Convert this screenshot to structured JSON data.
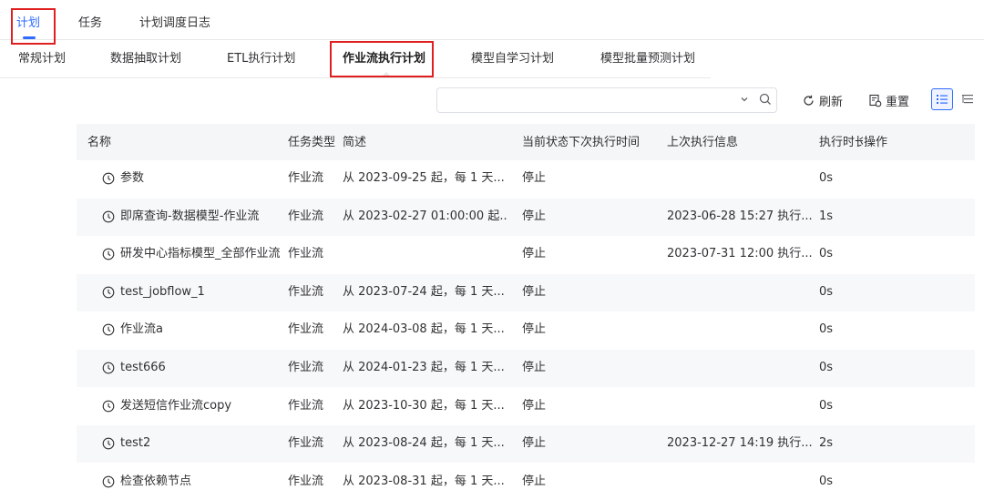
{
  "top_tabs": [
    {
      "label": "计划",
      "active": true
    },
    {
      "label": "任务",
      "active": false
    },
    {
      "label": "计划调度日志",
      "active": false
    }
  ],
  "sub_tabs": [
    {
      "label": "常规计划",
      "active": false
    },
    {
      "label": "数据抽取计划",
      "active": false
    },
    {
      "label": "ETL执行计划",
      "active": false
    },
    {
      "label": "作业流执行计划",
      "active": true
    },
    {
      "label": "模型自学习计划",
      "active": false
    },
    {
      "label": "模型批量预测计划",
      "active": false
    }
  ],
  "search": {
    "value": "",
    "placeholder": ""
  },
  "toolbar": {
    "refresh_label": "刷新",
    "reset_label": "重置"
  },
  "table": {
    "headers": {
      "name": "名称",
      "task_type": "任务类型",
      "description": "简述",
      "status": "当前状态",
      "next_time": "下次执行时间",
      "last_info": "上次执行信息",
      "duration": "执行时长",
      "actions": "操作"
    },
    "rows": [
      {
        "name": "参数",
        "task_type": "作业流",
        "description": "从 2023-09-25 起，每 1 天...",
        "status": "停止",
        "next_time": "",
        "last_info": "",
        "duration": "0s"
      },
      {
        "name": "即席查询-数据模型-作业流",
        "task_type": "作业流",
        "description": "从 2023-02-27 01:00:00 起...",
        "status": "停止",
        "next_time": "",
        "last_info": "2023-06-28 15:27 执行...",
        "duration": "1s"
      },
      {
        "name": "研发中心指标模型_全部作业流",
        "task_type": "作业流",
        "description": "",
        "status": "停止",
        "next_time": "",
        "last_info": "2023-07-31 12:00 执行...",
        "duration": "0s"
      },
      {
        "name": "test_jobflow_1",
        "task_type": "作业流",
        "description": "从 2023-07-24 起，每 1 天...",
        "status": "停止",
        "next_time": "",
        "last_info": "",
        "duration": "0s"
      },
      {
        "name": "作业流a",
        "task_type": "作业流",
        "description": "从 2024-03-08 起，每 1 天...",
        "status": "停止",
        "next_time": "",
        "last_info": "",
        "duration": "0s"
      },
      {
        "name": "test666",
        "task_type": "作业流",
        "description": "从 2024-01-23 起，每 1 天...",
        "status": "停止",
        "next_time": "",
        "last_info": "",
        "duration": "0s"
      },
      {
        "name": "发送短信作业流copy",
        "task_type": "作业流",
        "description": "从 2023-10-30 起，每 1 天...",
        "status": "停止",
        "next_time": "",
        "last_info": "",
        "duration": "0s"
      },
      {
        "name": "test2",
        "task_type": "作业流",
        "description": "从 2023-08-24 起，每 1 天...",
        "status": "停止",
        "next_time": "",
        "last_info": "2023-12-27 14:19 执行...",
        "duration": "2s"
      },
      {
        "name": "检查依赖节点",
        "task_type": "作业流",
        "description": "从 2023-08-31 起，每 1 天...",
        "status": "停止",
        "next_time": "",
        "last_info": "",
        "duration": "0s"
      }
    ]
  },
  "colors": {
    "accent": "#2f6bff",
    "highlight_box": "#e02020",
    "header_bg": "#f5f6f8",
    "alt_row_bg": "#f7f8fa"
  },
  "icons": {
    "row_icon": "clock-icon",
    "refresh": "refresh-icon",
    "reset": "reset-icon",
    "list_view": "list-view-icon",
    "tree_view": "tree-view-icon"
  }
}
